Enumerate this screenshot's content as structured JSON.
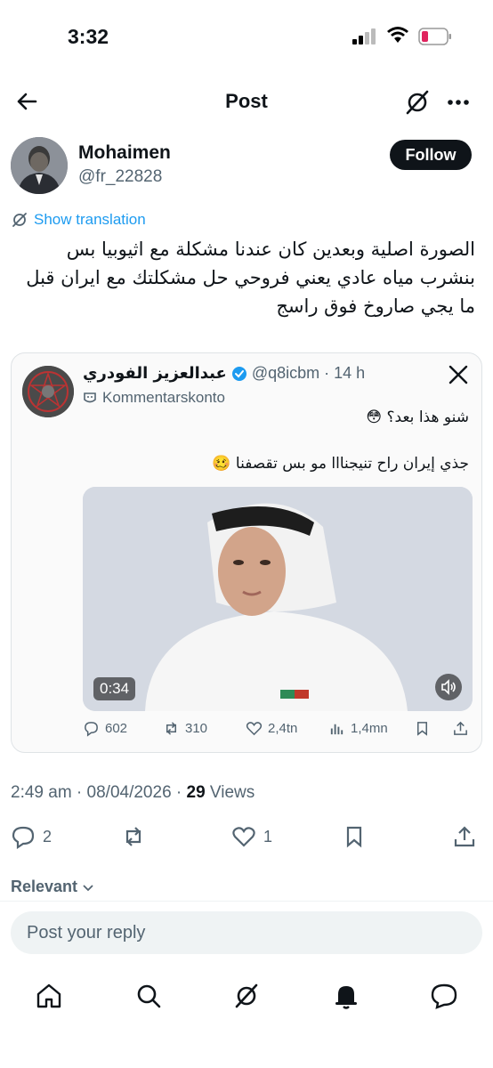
{
  "status": {
    "time": "3:32"
  },
  "header": {
    "title": "Post"
  },
  "author": {
    "name": "Mohaimen",
    "handle": "@fr_22828",
    "follow_label": "Follow"
  },
  "translation": {
    "label": "Show translation"
  },
  "tweet": {
    "lines": [
      "الصورة اصلية وبعدين كان عندنا مشكلة مع اثيوبيا بس",
      "بنشرب مياه عادي يعني فروحي حل مشكلتك مع ايران قبل",
      "ما يجي صاروخ فوق راسج"
    ]
  },
  "quote": {
    "name": "عبدالعزيز الفودري",
    "handle": "@q8icbm",
    "time": "· 14 h",
    "sub": "Kommentarskonto",
    "line1": "شنو هذا بعد؟ 😳",
    "line2": "جذي إيران راح تنيجنااا مو بس تقصفنا 🥴",
    "video_duration": "0:34",
    "replies": "602",
    "reposts": "310",
    "likes": "2,4tn",
    "views": "1,4mn"
  },
  "meta": {
    "timestamp": "2:49 am · 08/04/2026 · ",
    "views_count": "29",
    "views_label": " Views"
  },
  "actions": {
    "replies": "2",
    "likes": "1"
  },
  "relevant": {
    "label": "Relevant"
  },
  "reply": {
    "placeholder": "Post your reply"
  },
  "colors": {
    "accent": "#1d9bf0",
    "text": "#0f1419",
    "muted": "#536471",
    "battery": "#e0245e"
  }
}
